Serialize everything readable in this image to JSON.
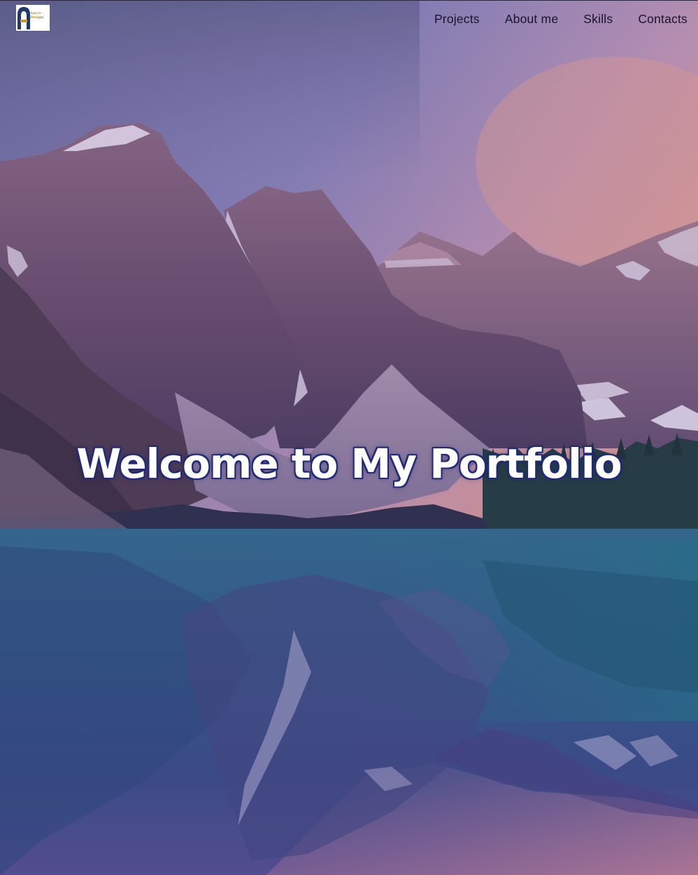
{
  "logo": {
    "line1": "Anjolo",
    "line2": "Design"
  },
  "nav": {
    "projects": "Projects",
    "about": "About me",
    "skills": "Skills",
    "contacts": "Contacts"
  },
  "hero": {
    "title": "Welcome to My Portfolio"
  },
  "colors": {
    "title_outline": "#1f2a7a",
    "nav_text": "#17152a",
    "overlay": "#5a4a9a"
  }
}
